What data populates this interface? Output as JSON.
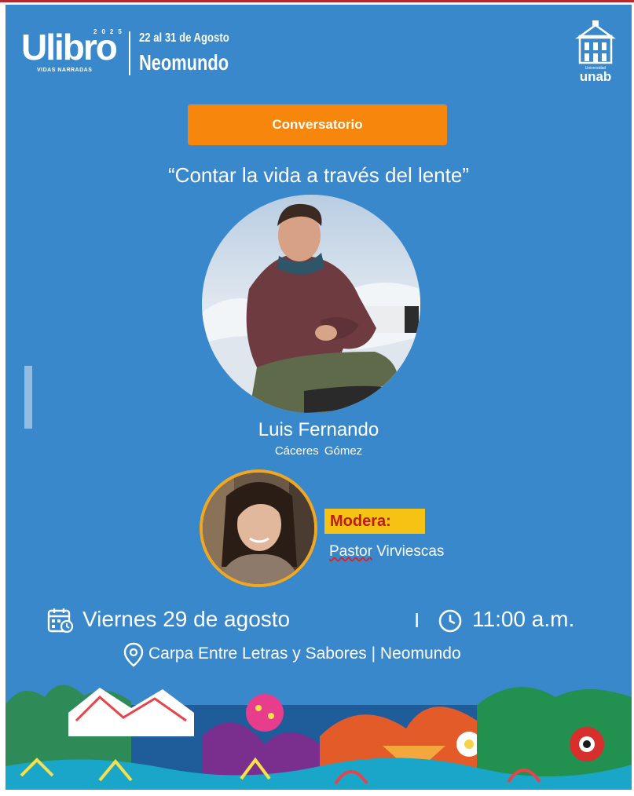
{
  "header": {
    "logo_word": "Ulibro",
    "logo_year": "2025",
    "logo_tagline": "VIDAS NARRADAS",
    "dates": "22 al 31 de Agosto",
    "venue": "Neomundo",
    "university_small": "Universidad",
    "university_word": "unab"
  },
  "event": {
    "type_tag": "Conversatorio",
    "title": "“Contar la vida a través del lente”"
  },
  "speaker": {
    "first_name": "Luis Fernando",
    "last_name": "Cáceres  Gómez"
  },
  "moderator": {
    "label": "Modera:",
    "first_name": "Pastor",
    "last_name": " Virviescas"
  },
  "schedule": {
    "date": "Viernes 29 de agosto",
    "separator": "I",
    "time": "11:00 a.m.",
    "place": "Carpa Entre Letras y Sabores | Neomundo"
  },
  "icons": {
    "calendar": "calendar-clock-icon",
    "clock": "clock-icon",
    "location": "location-pin-icon"
  },
  "colors": {
    "background": "#3a88cc",
    "tag": "#f7860d",
    "moderator_label_bg": "#f6c213",
    "moderator_label_text": "#c01a1a",
    "moderator_ring": "#f1a821"
  }
}
